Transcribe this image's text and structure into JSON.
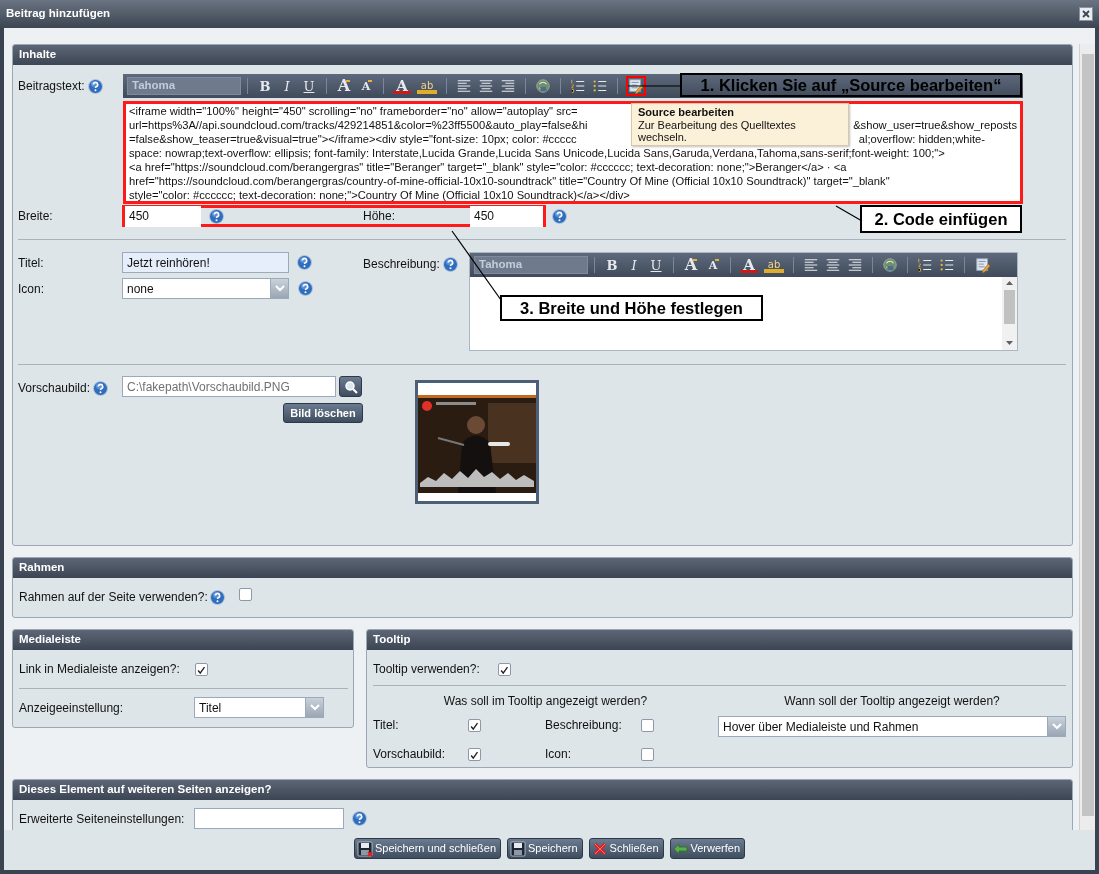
{
  "window": {
    "title": "Beitrag hinzufügen"
  },
  "inhalte": {
    "title": "Inhalte",
    "beitragstext": {
      "label": "Beitragstext:",
      "toolbar": {
        "font": {
          "value": "Tahoma",
          "disabled": true
        },
        "tools": [
          {
            "kind": "separator"
          },
          {
            "kind": "bold",
            "text": "B"
          },
          {
            "kind": "italic",
            "text": "I"
          },
          {
            "kind": "underline",
            "text": "U"
          },
          {
            "kind": "separator"
          },
          {
            "kind": "grow",
            "text": "A"
          },
          {
            "kind": "shrink",
            "text": "A"
          },
          {
            "kind": "separator"
          },
          {
            "kind": "font-color",
            "text": "A"
          },
          {
            "kind": "highlight",
            "text": "ab"
          },
          {
            "kind": "separator"
          },
          {
            "kind": "align-left"
          },
          {
            "kind": "align-center"
          },
          {
            "kind": "align-right"
          },
          {
            "kind": "separator"
          },
          {
            "kind": "link"
          },
          {
            "kind": "separator"
          },
          {
            "kind": "ordered-list"
          },
          {
            "kind": "bullet-list"
          },
          {
            "kind": "separator"
          },
          {
            "kind": "source",
            "highlighted": true
          }
        ]
      },
      "code": [
        {
          "left": "<iframe width=\"100%\" height=\"450\" scrolling=\"no\" frameborder=\"no\" allow=\"autoplay\" src="
        },
        {
          "left": "url=https%3A//api.soundcloud.com/tracks/429214851&color=%23ff5500&auto_play=false&hi",
          "right": "&show_user=true&show_reposts"
        },
        {
          "left": "=false&show_teaser=true&visual=true\"></iframe><div style=\"font-size: 10px; color: #ccccc",
          "right": "al;overflow: hidden;white-"
        },
        {
          "left": "space: nowrap;text-overflow: ellipsis; font-family: Interstate,Lucida Grande,Lucida Sans Unicode,Lucida Sans,Garuda,Verdana,Tahoma,sans-serif;font-weight: 100;\">"
        },
        {
          "left": "<a href=\"https://soundcloud.com/berangergras\" title=\"Beranger\" target=\"_blank\" style=\"color: #cccccc; text-decoration: none;\">Beranger</a> · <a"
        },
        {
          "left": "href=\"https://soundcloud.com/berangergras/country-of-mine-official-10x10-soundtrack\" title=\"Country Of Mine (Official 10x10 Soundtrack)\" target=\"_blank\""
        },
        {
          "left": "style=\"color: #cccccc; text-decoration: none;\">Country Of Mine (Official 10x10 Soundtrack)</a></div>"
        }
      ],
      "tooltip": {
        "title": "Source bearbeiten",
        "text": "Zur Bearbeitung des Quelltextes wechseln."
      }
    },
    "breite": {
      "label": "Breite:",
      "value": "450"
    },
    "hoehe": {
      "label": "Höhe:",
      "value": "450"
    },
    "titel": {
      "label": "Titel:",
      "value": "Jetzt reinhören!"
    },
    "icon": {
      "label": "Icon:",
      "value": "none"
    },
    "beschreibung": {
      "label": "Beschreibung:",
      "toolbar": {
        "font": {
          "value": "Tahoma",
          "disabled": true
        },
        "tools": [
          {
            "kind": "separator"
          },
          {
            "kind": "bold",
            "text": "B"
          },
          {
            "kind": "italic",
            "text": "I"
          },
          {
            "kind": "underline",
            "text": "U"
          },
          {
            "kind": "separator"
          },
          {
            "kind": "grow",
            "text": "A"
          },
          {
            "kind": "shrink",
            "text": "A"
          },
          {
            "kind": "separator"
          },
          {
            "kind": "font-color",
            "text": "A"
          },
          {
            "kind": "highlight",
            "text": "ab"
          },
          {
            "kind": "separator"
          },
          {
            "kind": "align-left"
          },
          {
            "kind": "align-center"
          },
          {
            "kind": "align-right"
          },
          {
            "kind": "separator"
          },
          {
            "kind": "link"
          },
          {
            "kind": "separator"
          },
          {
            "kind": "ordered-list"
          },
          {
            "kind": "bullet-list"
          },
          {
            "kind": "separator"
          },
          {
            "kind": "source",
            "highlighted": false
          }
        ]
      }
    },
    "vorschaubild": {
      "label": "Vorschaubild:",
      "value": "C:\\fakepath\\Vorschaubild.PNG",
      "delete_button": "Bild löschen"
    }
  },
  "rahmen": {
    "title": "Rahmen",
    "label": "Rahmen auf der Seite verwenden?:",
    "checked": false
  },
  "medialeiste": {
    "title": "Medialeiste",
    "link": {
      "label": "Link in Medialeiste anzeigen?:",
      "checked": true
    },
    "anzeige": {
      "label": "Anzeigeeinstellung:",
      "value": "Titel"
    }
  },
  "tooltip": {
    "title": "Tooltip",
    "use": {
      "label": "Tooltip verwenden?:",
      "checked": true
    },
    "what_heading": "Was soll im Tooltip angezeigt werden?",
    "options": [
      {
        "label": "Titel:",
        "checked": true
      },
      {
        "label": "Beschreibung:",
        "checked": false
      },
      {
        "label": "Vorschaubild:",
        "checked": true
      },
      {
        "label": "Icon:",
        "checked": false
      }
    ],
    "when_heading": "Wann soll der Tooltip angezeigt werden?",
    "when_value": "Hover über Medialeiste und Rahmen"
  },
  "weitere": {
    "title": "Dieses Element auf weiteren Seiten anzeigen?",
    "label": "Erweiterte Seiteneinstellungen:"
  },
  "buttons": [
    {
      "label": "Speichern und schließen",
      "kind": "save-close"
    },
    {
      "label": "Speichern",
      "kind": "save"
    },
    {
      "label": "Schließen",
      "kind": "close"
    },
    {
      "label": "Verwerfen",
      "kind": "discard"
    }
  ],
  "callouts": [
    {
      "text": "1. Klicken Sie auf „Source bearbeiten“",
      "kind": "transparent"
    },
    {
      "text": "2. Code einfügen",
      "kind": "boxed"
    },
    {
      "text": "3. Breite und Höhe festlegen",
      "kind": "boxed"
    }
  ]
}
